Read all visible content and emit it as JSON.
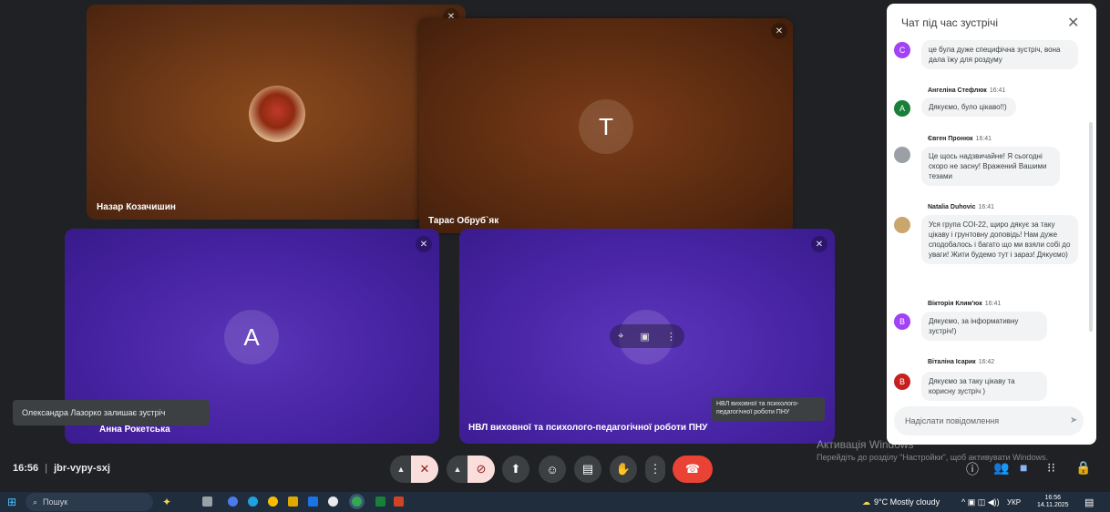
{
  "tiles": {
    "nazar": {
      "name": "Назар Козачишин"
    },
    "taras": {
      "name": "Тарас Обруб`як",
      "initial": "Т"
    },
    "anna": {
      "name": "Анна Рокетська",
      "initial": "А"
    },
    "nvl": {
      "name": "НВЛ виховної та психолого-педагогічної роботи ПНУ"
    }
  },
  "toast": {
    "text": "Олександра Лазорко залишає зустріч"
  },
  "tooltip": {
    "text": "НВЛ виховної та психолого-педагогічної роботи ПНУ"
  },
  "meeting": {
    "time": "16:56",
    "separator": "|",
    "code": "jbr-vypy-sxj"
  },
  "activation": {
    "line1": "Активація Windows",
    "line2": "Перейдіть до розділу \"Настройки\", щоб активувати Windows."
  },
  "chat": {
    "title": "Чат під час зустрічі",
    "input_placeholder": "Надіслати повідомлення",
    "messages": [
      {
        "author": "",
        "time": "",
        "initial": "С",
        "color": "#a142f4",
        "text": "це була дуже специфічна зустріч, вона дала їжу для роздуму"
      },
      {
        "author": "Ангеліна Стефлюк",
        "time": "16:41",
        "initial": "А",
        "color": "#188038",
        "text": "Дякуємо, було цікаво!!)"
      },
      {
        "author": "Євген Пронюк",
        "time": "16:41",
        "initial": "",
        "color": "#9aa0a6",
        "text": "Це щось надзвичайне! Я сьогодні скоро не засну! Вражений Вашими тезами"
      },
      {
        "author": "Natalia Duhovic",
        "time": "16:41",
        "initial": "",
        "color": "#c9a66b",
        "text": "Уся група СОІ-22, щиро дякує за таку цікаву і грунтовну доповідь! Нам дуже сподобалось і багато що ми взяли собі до уваги! Жити будемо тут і зараз! Дякуємо)"
      },
      {
        "author": "Вікторія Клим'юк",
        "time": "16:41",
        "initial": "В",
        "color": "#a142f4",
        "text": "Дякуємо, за інформативну зустріч!)"
      },
      {
        "author": "Віталіна Ісарик",
        "time": "16:42",
        "initial": "В",
        "color": "#c5221f",
        "text": "Дякуємо за таку цікаву та корисну зустріч )"
      }
    ]
  },
  "taskbar": {
    "search": "Пошук",
    "weather": "9°C  Mostly cloudy",
    "lang": "УКР",
    "time": "16:56",
    "date": "14.11.2025"
  }
}
